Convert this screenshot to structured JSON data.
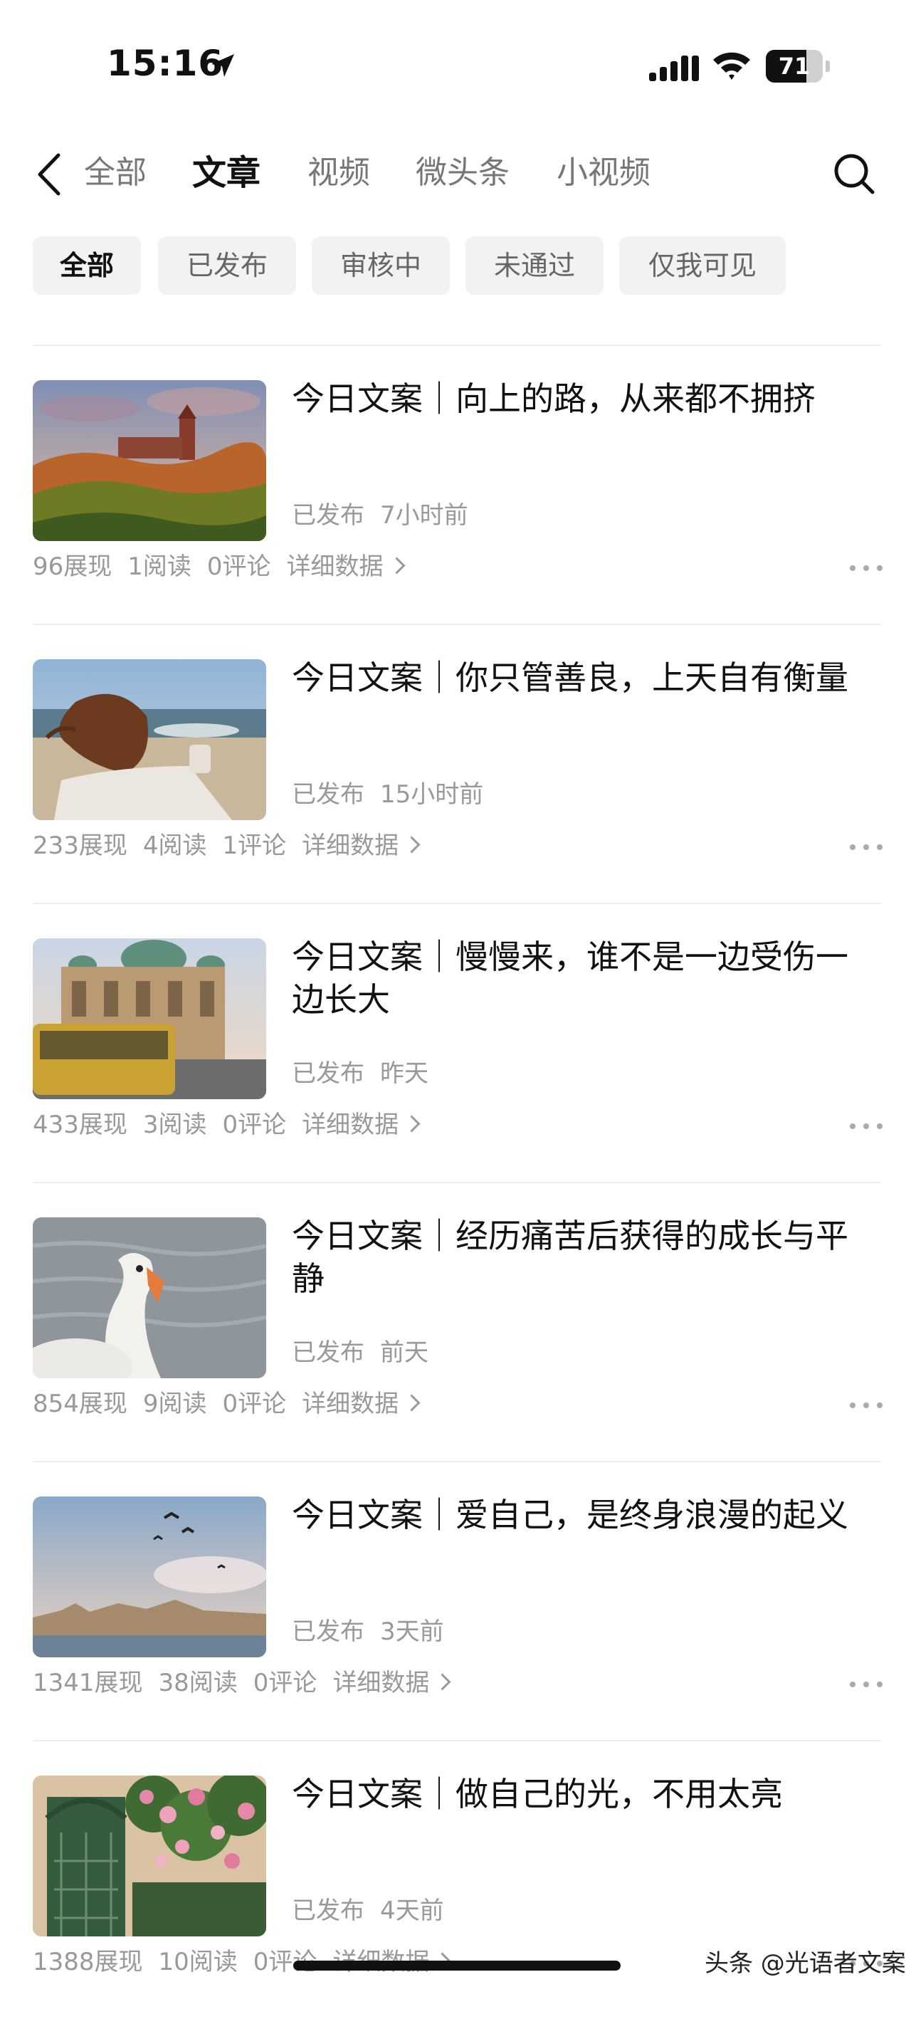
{
  "status_bar": {
    "time": "15:16",
    "battery": "71",
    "battery_level": 0.71
  },
  "nav": {
    "tabs": [
      {
        "label": "全部"
      },
      {
        "label": "文章",
        "active": true
      },
      {
        "label": "视频"
      },
      {
        "label": "微头条"
      },
      {
        "label": "小视频"
      }
    ]
  },
  "filters": [
    {
      "label": "全部",
      "active": true
    },
    {
      "label": "已发布"
    },
    {
      "label": "审核中"
    },
    {
      "label": "未通过"
    },
    {
      "label": "仅我可见"
    }
  ],
  "articles": [
    {
      "title": "今日文案｜向上的路，从来都不拥挤",
      "status": "已发布",
      "time": "7小时前",
      "impressions": "96展现",
      "reads": "1阅读",
      "comments": "0评论",
      "detail": "详细数据"
    },
    {
      "title": "今日文案｜你只管善良，上天自有衡量",
      "status": "已发布",
      "time": "15小时前",
      "impressions": "233展现",
      "reads": "4阅读",
      "comments": "1评论",
      "detail": "详细数据"
    },
    {
      "title": "今日文案｜慢慢来，谁不是一边受伤一边长大",
      "status": "已发布",
      "time": "昨天",
      "impressions": "433展现",
      "reads": "3阅读",
      "comments": "0评论",
      "detail": "详细数据"
    },
    {
      "title": "今日文案｜经历痛苦后获得的成长与平静",
      "status": "已发布",
      "time": "前天",
      "impressions": "854展现",
      "reads": "9阅读",
      "comments": "0评论",
      "detail": "详细数据"
    },
    {
      "title": "今日文案｜爱自己，是终身浪漫的起义",
      "status": "已发布",
      "time": "3天前",
      "impressions": "1341展现",
      "reads": "38阅读",
      "comments": "0评论",
      "detail": "详细数据"
    },
    {
      "title": "今日文案｜做自己的光，不用太亮",
      "status": "已发布",
      "time": "4天前",
      "impressions": "1388展现",
      "reads": "10阅读",
      "comments": "0评论",
      "detail": "详细数据"
    }
  ],
  "watermark": "头条 @光语者文案"
}
